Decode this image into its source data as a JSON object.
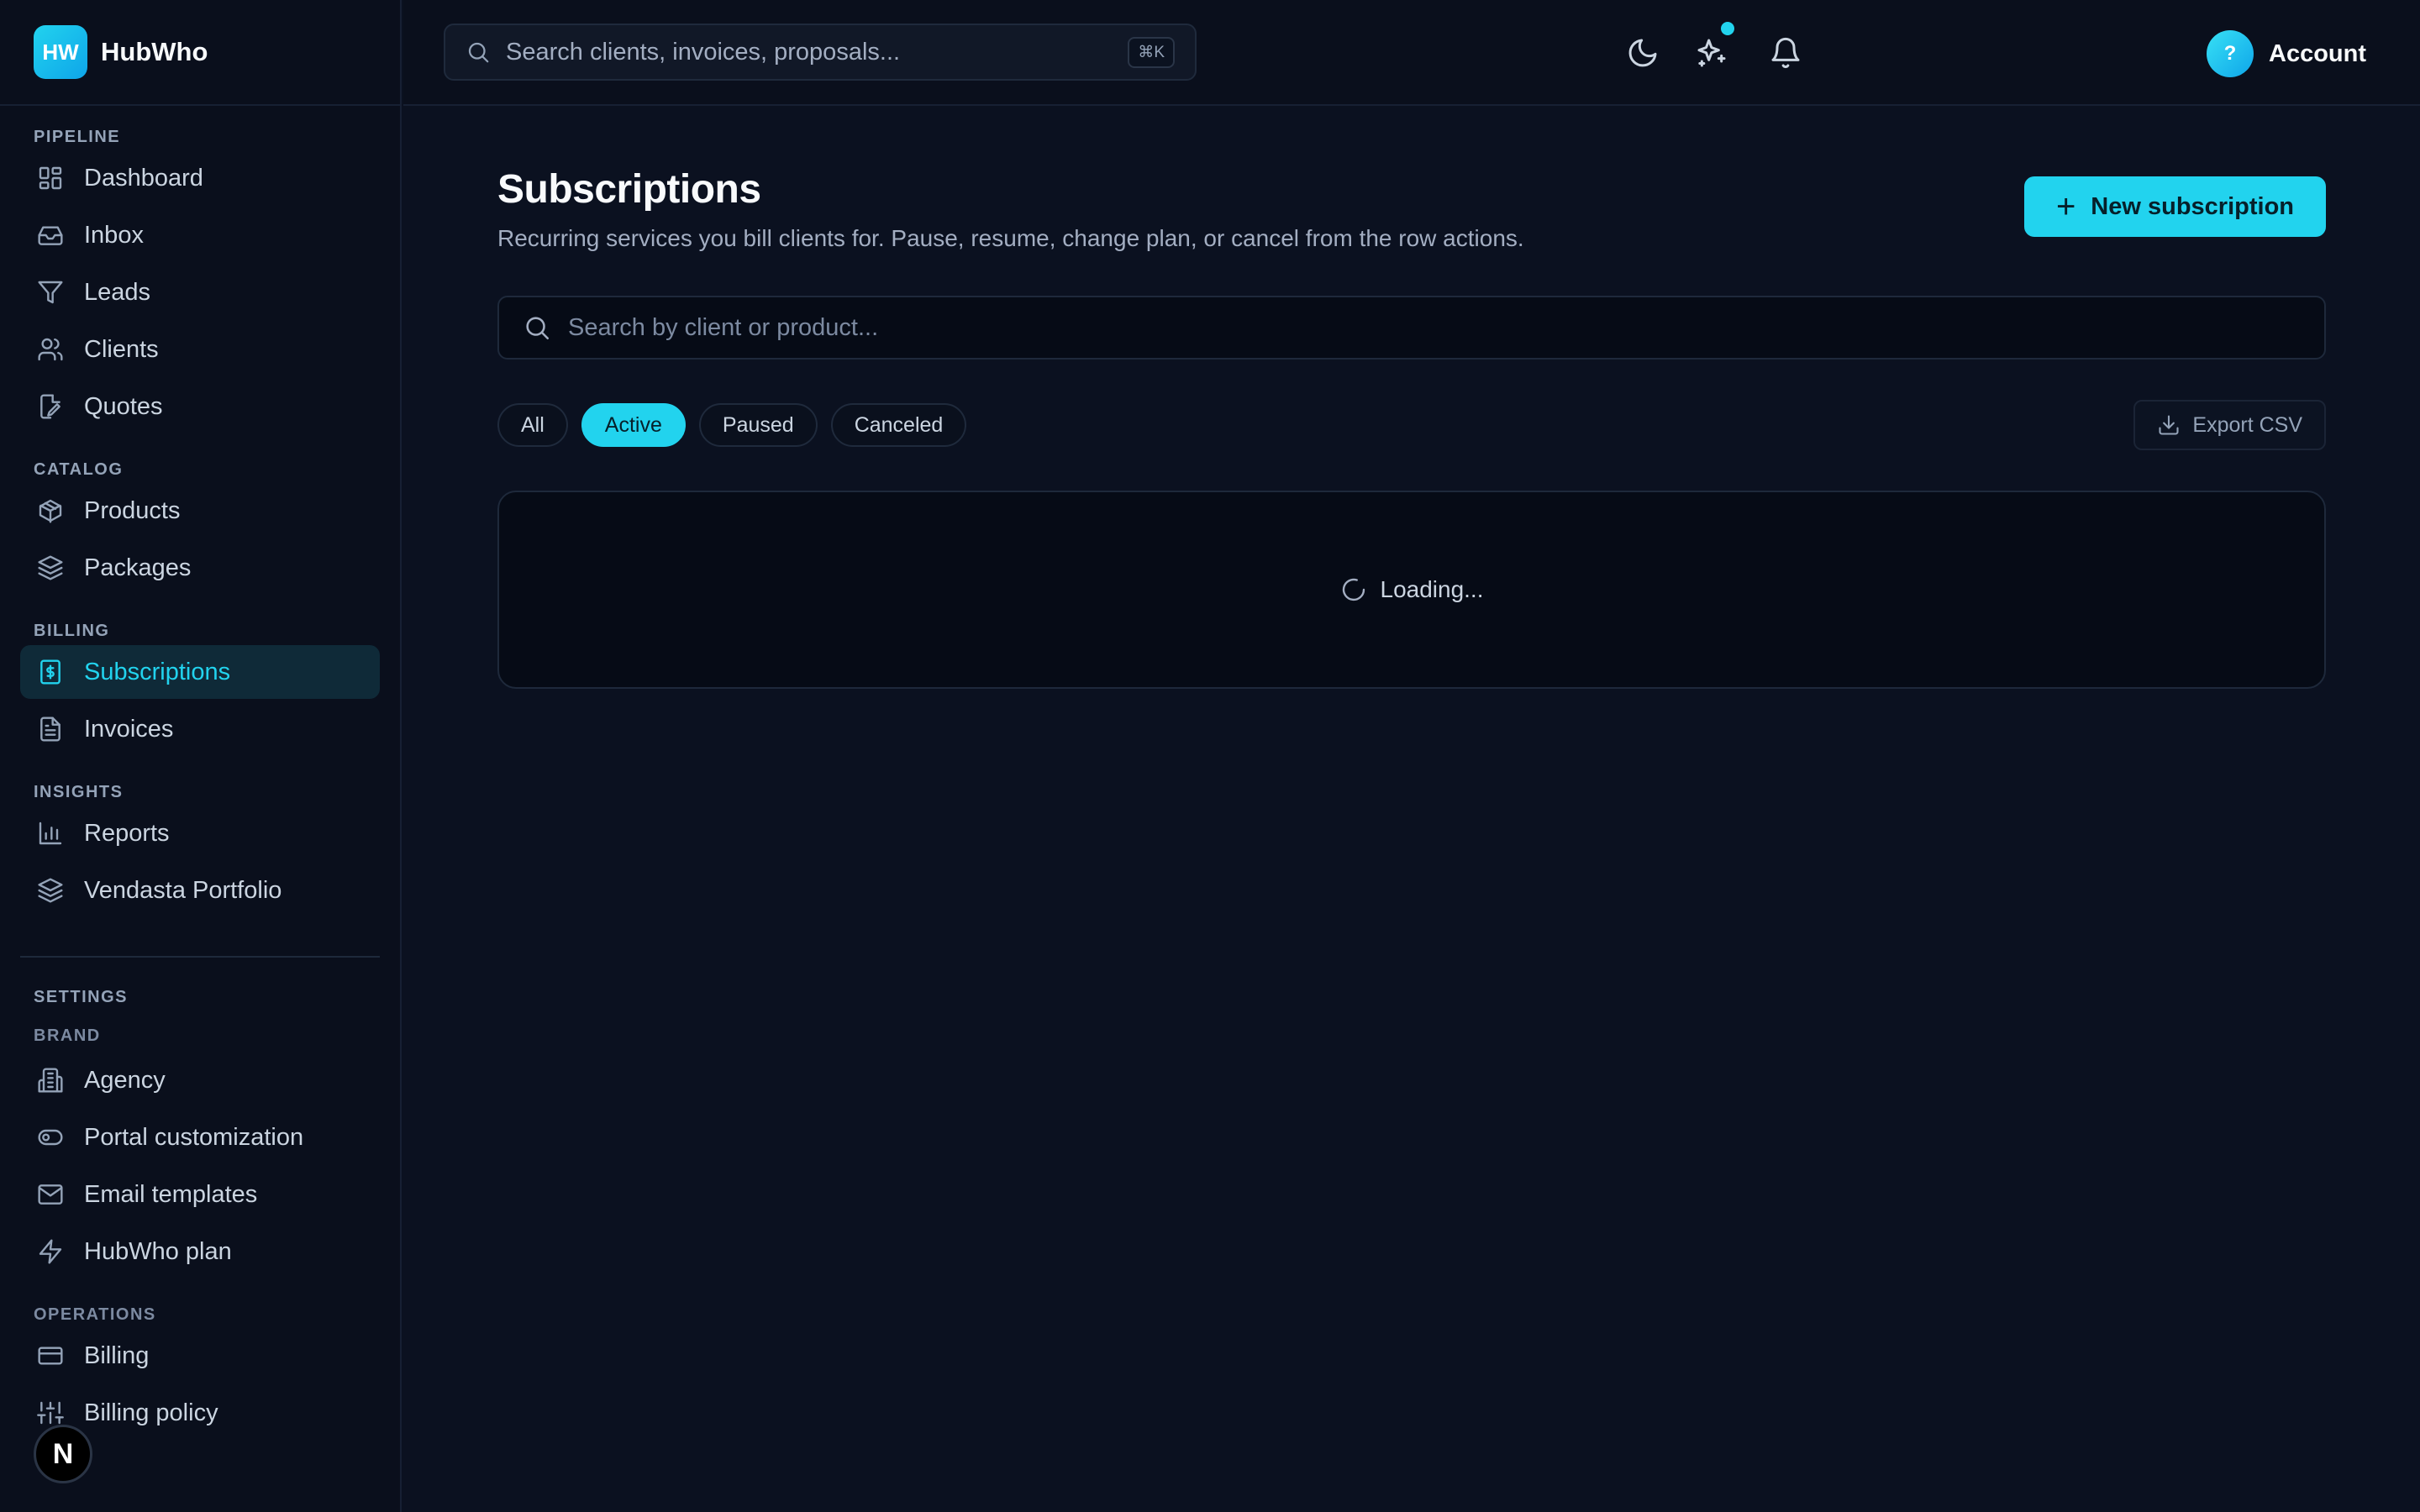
{
  "brand": {
    "logo_text": "HW",
    "name": "HubWho"
  },
  "topbar": {
    "search_placeholder": "Search clients, invoices, proposals...",
    "search_shortcut": "⌘K",
    "account_avatar": "?",
    "account_label": "Account"
  },
  "sidebar": {
    "pipeline": {
      "label": "PIPELINE",
      "items": [
        {
          "label": "Dashboard",
          "icon": "dashboard-icon"
        },
        {
          "label": "Inbox",
          "icon": "inbox-icon"
        },
        {
          "label": "Leads",
          "icon": "filter-icon"
        },
        {
          "label": "Clients",
          "icon": "users-icon"
        },
        {
          "label": "Quotes",
          "icon": "quote-edit-icon"
        }
      ]
    },
    "catalog": {
      "label": "CATALOG",
      "items": [
        {
          "label": "Products",
          "icon": "package-icon"
        },
        {
          "label": "Packages",
          "icon": "layers-icon"
        }
      ]
    },
    "billing": {
      "label": "BILLING",
      "items": [
        {
          "label": "Subscriptions",
          "icon": "receipt-dollar-icon",
          "active": true
        },
        {
          "label": "Invoices",
          "icon": "file-text-icon"
        }
      ]
    },
    "insights": {
      "label": "INSIGHTS",
      "items": [
        {
          "label": "Reports",
          "icon": "bar-chart-icon"
        },
        {
          "label": "Vendasta Portfolio",
          "icon": "layers-icon"
        }
      ]
    },
    "settings": {
      "label": "SETTINGS",
      "brand_label": "BRAND",
      "items": [
        {
          "label": "Agency",
          "icon": "building-icon"
        },
        {
          "label": "Portal customization",
          "icon": "toggle-icon"
        },
        {
          "label": "Email templates",
          "icon": "mail-icon"
        },
        {
          "label": "HubWho plan",
          "icon": "zap-icon"
        }
      ],
      "operations_label": "OPERATIONS",
      "operations_items": [
        {
          "label": "Billing",
          "icon": "credit-card-icon"
        },
        {
          "label": "Billing policy",
          "icon": "sliders-icon"
        }
      ]
    },
    "floating_badge": "N"
  },
  "main": {
    "title": "Subscriptions",
    "subtitle": "Recurring services you bill clients for. Pause, resume, change plan, or cancel from the row actions.",
    "new_button": "New subscription",
    "search_placeholder": "Search by client or product...",
    "filters": [
      {
        "label": "All",
        "active": false
      },
      {
        "label": "Active",
        "active": true
      },
      {
        "label": "Paused",
        "active": false
      },
      {
        "label": "Canceled",
        "active": false
      }
    ],
    "export_label": "Export CSV",
    "loading_text": "Loading..."
  },
  "colors": {
    "accent": "#22d3ee",
    "background": "#0b1120",
    "sidebar": "#0a0f1c"
  }
}
